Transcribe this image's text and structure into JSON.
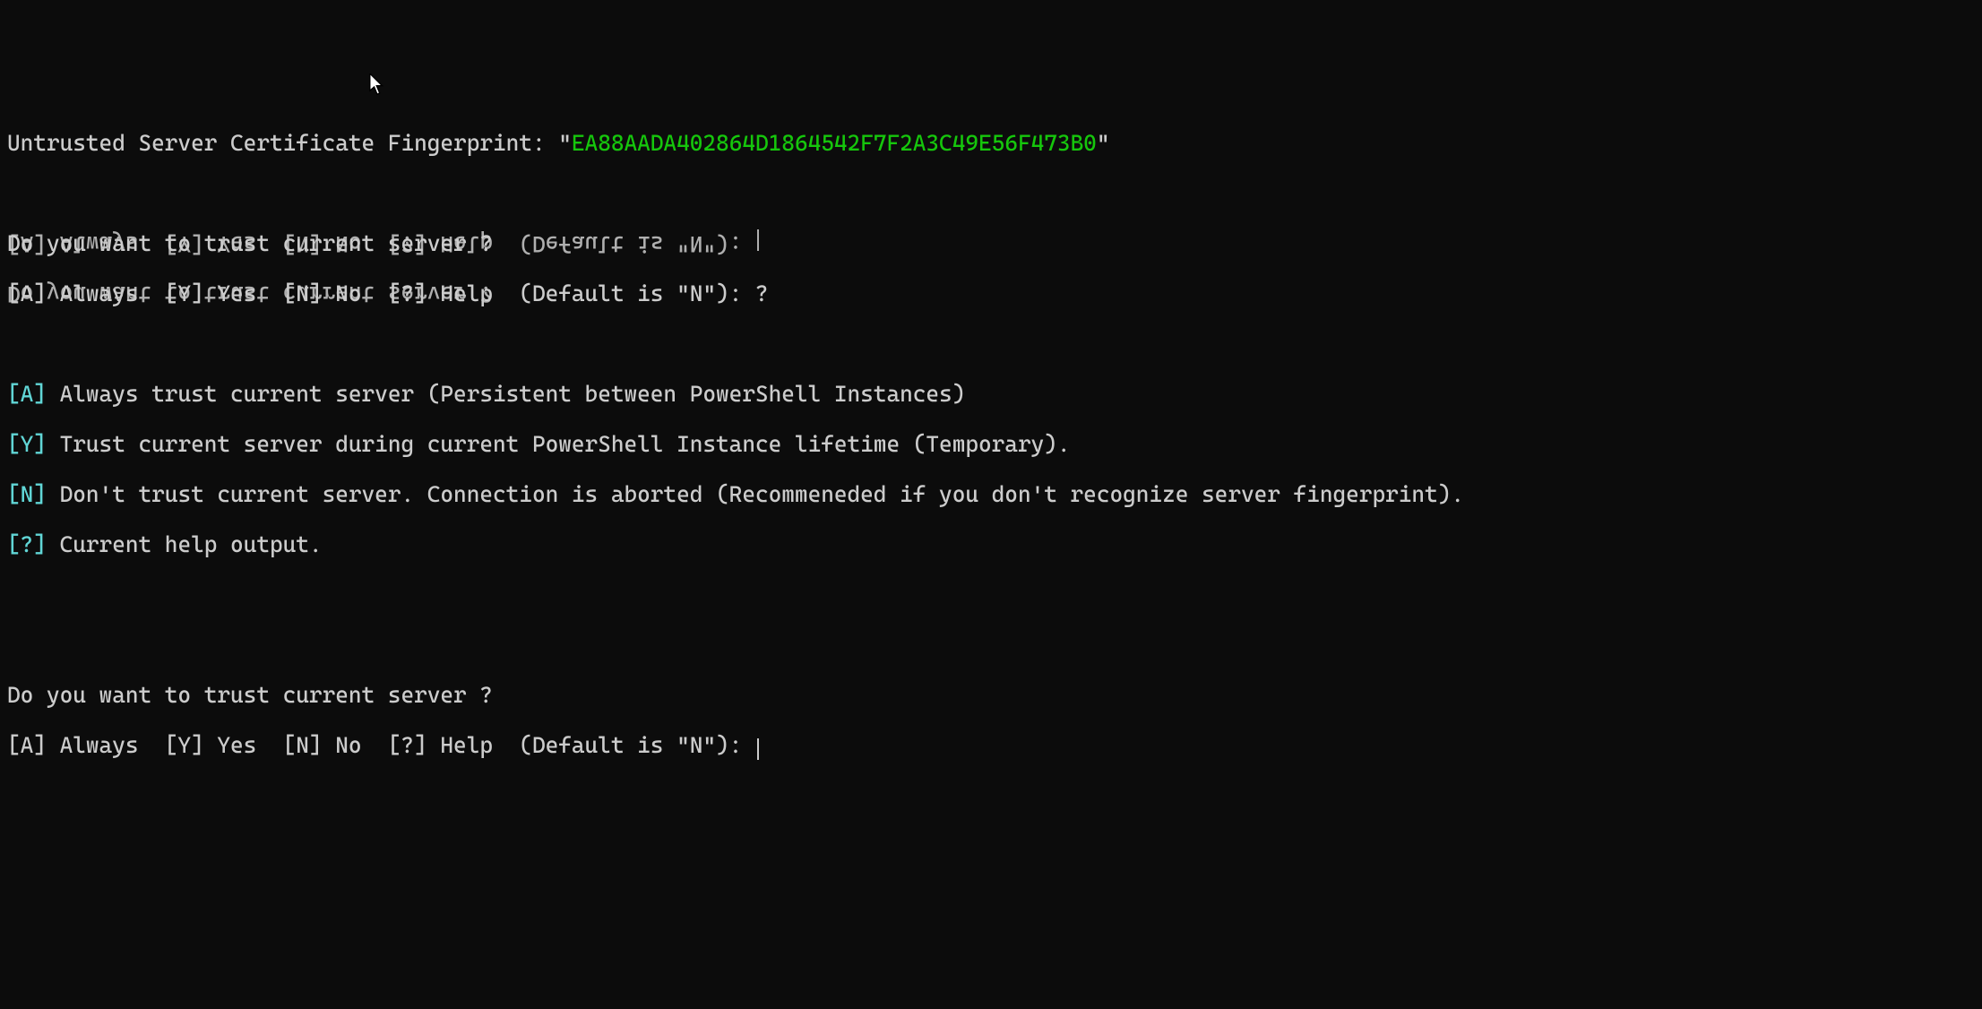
{
  "header": {
    "label": "Untrusted Server Certificate Fingerprint: ",
    "quote_open": "\"",
    "fingerprint": "EA88AADA402864D1864542F7F2A3C49E56F473B0",
    "quote_close": "\""
  },
  "prompt1": {
    "question": "Do you want to trust current server ?",
    "options": "[A] Always  [Y] Yes  [N] No  [?] Help  (Default is \"N\"): ?"
  },
  "help": {
    "a_key": "[A]",
    "a_text": " Always trust current server (Persistent between PowerShell Instances)",
    "y_key": "[Y]",
    "y_text": " Trust current server during current PowerShell Instance lifetime (Temporary).",
    "n_key": "[N]",
    "n_text": " Don't trust current server. Connection is aborted (Recommeneded if you don't recognize server fingerprint).",
    "q_key": "[?]",
    "q_text": " Current help output."
  },
  "prompt2": {
    "question": "Do you want to trust current server ?",
    "options": "[A] Always  [Y] Yes  [N] No  [?] Help  (Default is \"N\"): "
  }
}
